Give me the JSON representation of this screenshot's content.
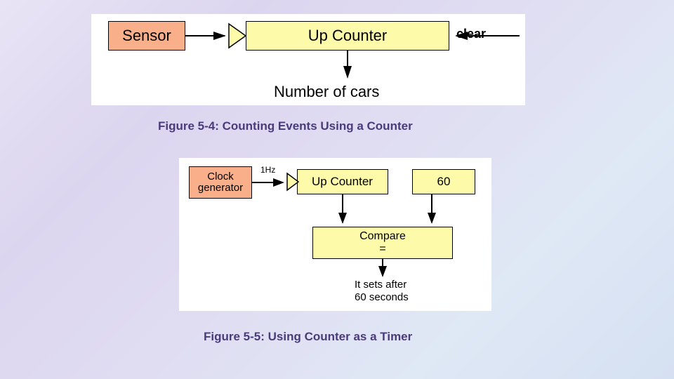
{
  "caption1": "Figure 5-4: Counting Events Using a Counter",
  "caption2": "Figure 5-5: Using Counter as a Timer",
  "fig1": {
    "sensor": "Sensor",
    "upcounter": "Up Counter",
    "clear": "clear",
    "output": "Number of cars"
  },
  "fig2": {
    "clockgen_line1": "Clock",
    "clockgen_line2": "generator",
    "freq": "1Hz",
    "upcounter": "Up Counter",
    "sixty": "60",
    "compare_line1": "Compare",
    "compare_line2": "=",
    "output_line1": "It sets after",
    "output_line2": "60 seconds"
  }
}
